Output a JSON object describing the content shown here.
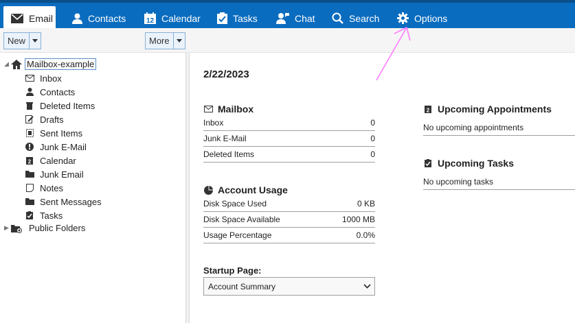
{
  "nav": {
    "tabs": [
      {
        "label": "Email",
        "icon": "envelope-icon"
      },
      {
        "label": "Contacts",
        "icon": "person-icon"
      },
      {
        "label": "Calendar",
        "icon": "calendar-icon"
      },
      {
        "label": "Tasks",
        "icon": "clipboard-check-icon"
      },
      {
        "label": "Chat",
        "icon": "chat-person-icon"
      },
      {
        "label": "Search",
        "icon": "search-icon"
      },
      {
        "label": "Options",
        "icon": "gear-icon"
      }
    ],
    "calendar_day": "12"
  },
  "toolbar": {
    "new_label": "New",
    "more_label": "More"
  },
  "tree": {
    "root": "Mailbox-example",
    "folders": [
      {
        "label": "Inbox",
        "icon": "envelope-icon"
      },
      {
        "label": "Contacts",
        "icon": "person-icon"
      },
      {
        "label": "Deleted Items",
        "icon": "trash-icon"
      },
      {
        "label": "Drafts",
        "icon": "draft-icon"
      },
      {
        "label": "Sent Items",
        "icon": "sent-icon"
      },
      {
        "label": "Junk E-Mail",
        "icon": "exclamation-icon"
      },
      {
        "label": "Calendar",
        "icon": "calendar-icon"
      },
      {
        "label": "Junk Email",
        "icon": "folder-icon"
      },
      {
        "label": "Notes",
        "icon": "note-icon"
      },
      {
        "label": "Sent Messages",
        "icon": "folder-icon"
      },
      {
        "label": "Tasks",
        "icon": "clipboard-check-icon"
      }
    ],
    "public": "Public Folders",
    "calendar_day": "2"
  },
  "summary": {
    "date": "2/22/2023",
    "mailbox": {
      "title": "Mailbox",
      "rows": [
        {
          "label": "Inbox",
          "value": "0"
        },
        {
          "label": "Junk E-Mail",
          "value": "0"
        },
        {
          "label": "Deleted Items",
          "value": "0"
        }
      ]
    },
    "usage": {
      "title": "Account Usage",
      "rows": [
        {
          "label": "Disk Space Used",
          "value": "0 KB"
        },
        {
          "label": "Disk Space Available",
          "value": "1000 MB"
        },
        {
          "label": "Usage Percentage",
          "value": "0.0%"
        }
      ]
    },
    "appointments": {
      "title": "Upcoming Appointments",
      "empty": "No upcoming appointments",
      "calendar_day": "2"
    },
    "tasks": {
      "title": "Upcoming Tasks",
      "empty": "No upcoming tasks"
    },
    "startup": {
      "label": "Startup Page:",
      "value": "Account Summary"
    }
  },
  "colors": {
    "nav_bg": "#0a6cbf",
    "annotation": "#ff7cff"
  }
}
